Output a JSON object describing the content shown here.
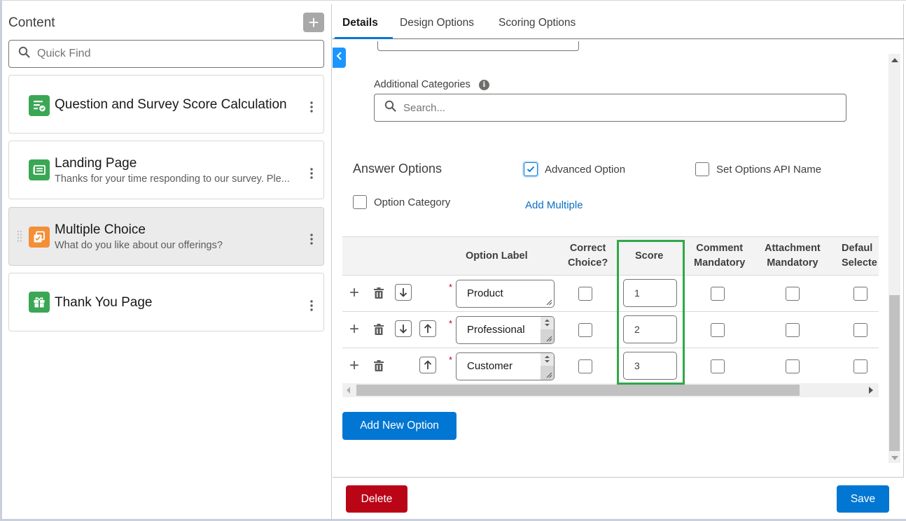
{
  "left_panel": {
    "title": "Content",
    "add_icon": "plus-icon",
    "search": {
      "placeholder": "Quick Find",
      "value": "",
      "icon": "search-icon"
    },
    "items": [
      {
        "title": "Question and Survey Score Calculation",
        "subtitle": "",
        "icon": "score-calculation-icon",
        "icon_color": "#3ba755",
        "selected": false
      },
      {
        "title": "Landing Page",
        "subtitle": "Thanks for your time responding to our survey. Ple...",
        "icon": "landing-page-icon",
        "icon_color": "#3ba755",
        "selected": false
      },
      {
        "title": "Multiple Choice",
        "subtitle": "What do you like about our offerings?",
        "icon": "multiple-choice-icon",
        "icon_color": "#f38f37",
        "selected": true
      },
      {
        "title": "Thank You Page",
        "subtitle": "",
        "icon": "gift-icon",
        "icon_color": "#3ba755",
        "selected": false
      }
    ]
  },
  "tabs": [
    {
      "label": "Details",
      "active": true
    },
    {
      "label": "Design Options",
      "active": false
    },
    {
      "label": "Scoring Options",
      "active": false
    }
  ],
  "details": {
    "additional_categories": {
      "label": "Additional Categories",
      "placeholder": "Search...",
      "value": ""
    },
    "answer_options": {
      "title": "Answer Options",
      "advanced_option": {
        "label": "Advanced Option",
        "checked": true
      },
      "set_options_api_name": {
        "label": "Set Options API Name",
        "checked": false
      },
      "option_category": {
        "label": "Option Category",
        "checked": false
      },
      "add_multiple_label": "Add Multiple"
    },
    "table": {
      "headers": {
        "option_label": "Option Label",
        "correct_choice": [
          "Correct",
          "Choice?"
        ],
        "score": "Score",
        "comment_mandatory": [
          "Comment",
          "Mandatory"
        ],
        "attachment_mandatory": [
          "Attachment",
          "Mandatory"
        ],
        "default_selected": [
          "Defaul",
          "Selecte"
        ]
      },
      "rows": [
        {
          "label": "Product",
          "score": "1",
          "correct": false,
          "comment": false,
          "attachment": false,
          "default": false,
          "move_down": true,
          "move_up": false
        },
        {
          "label": "Professional",
          "score": "2",
          "correct": false,
          "comment": false,
          "attachment": false,
          "default": false,
          "move_down": true,
          "move_up": true
        },
        {
          "label": "Customer",
          "score": "3",
          "correct": false,
          "comment": false,
          "attachment": false,
          "default": false,
          "move_down": false,
          "move_up": true
        }
      ],
      "highlight_color": "#2ea84a"
    },
    "add_new_option_label": "Add New Option"
  },
  "footer": {
    "delete_label": "Delete",
    "save_label": "Save"
  },
  "colors": {
    "brand_blue": "#0176d3",
    "destructive_red": "#ba0517",
    "highlight_green": "#2ea84a"
  }
}
